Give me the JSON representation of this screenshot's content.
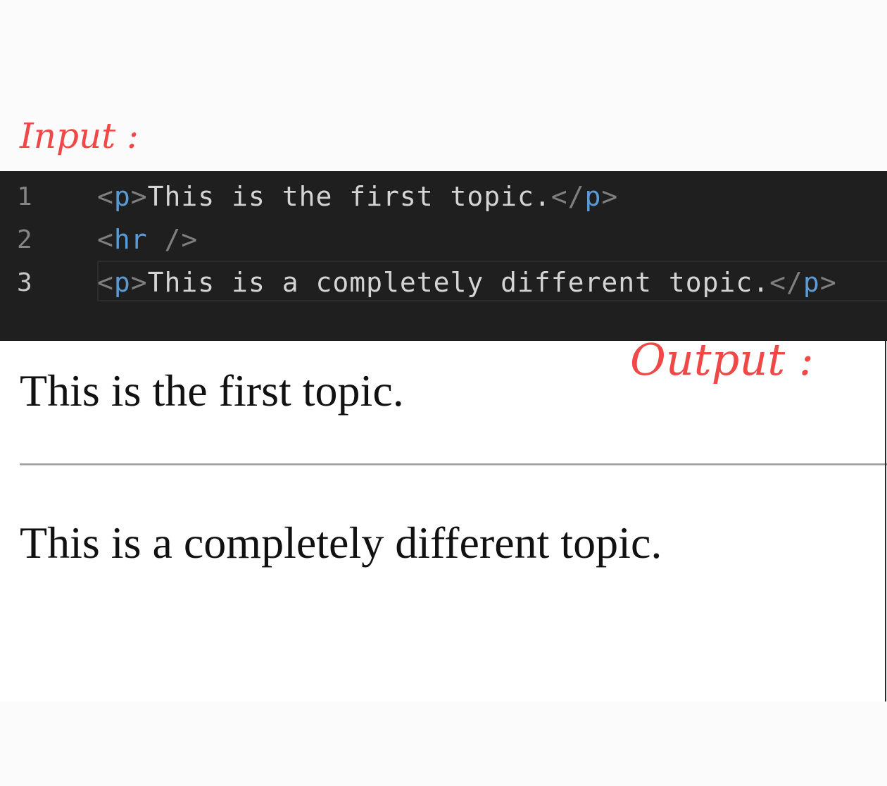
{
  "labels": {
    "input": "Input :",
    "output": "Output :"
  },
  "editor": {
    "lines": [
      {
        "number": "1",
        "open_lt": "<",
        "open_tag": "p",
        "open_gt": ">",
        "text": "This is the first topic.",
        "close_lt": "</",
        "close_tag": "p",
        "close_gt": ">"
      },
      {
        "number": "2",
        "open_lt": "<",
        "tag": "hr",
        "self_close": " />"
      },
      {
        "number": "3",
        "open_lt": "<",
        "open_tag": "p",
        "open_gt": ">",
        "text": "This is a completely different topic.",
        "close_lt": "</",
        "close_tag": "p",
        "close_gt": ">"
      }
    ]
  },
  "output": {
    "paragraph_1": "This is the first topic.",
    "paragraph_2": "This is a completely different topic."
  },
  "colors": {
    "annotation": "#f04747",
    "editor_bg": "#1f1f1f",
    "tag": "#5a9bd6",
    "punctuation": "#7f7f7f",
    "code_text": "#d4d4d4"
  }
}
